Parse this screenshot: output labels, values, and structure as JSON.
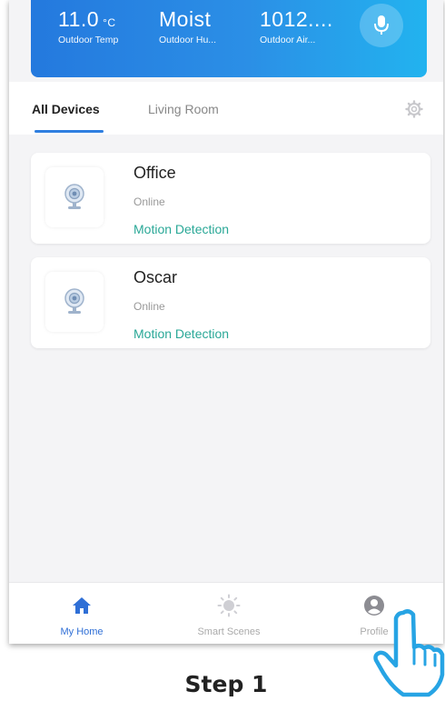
{
  "weather": {
    "temp": {
      "value": "11.0",
      "unit": "°C",
      "label": "Outdoor Temp"
    },
    "humidity": {
      "value": "Moist",
      "label": "Outdoor Hu..."
    },
    "air": {
      "value": "1012....",
      "label": "Outdoor Air..."
    },
    "mic_icon": "microphone-icon"
  },
  "tabs": {
    "items": [
      {
        "label": "All Devices",
        "active": true
      },
      {
        "label": "Living Room",
        "active": false
      }
    ],
    "settings_icon": "gear-icon"
  },
  "devices": [
    {
      "name": "Office",
      "status": "Online",
      "feature": "Motion Detection",
      "icon": "camera-icon"
    },
    {
      "name": "Oscar",
      "status": "Online",
      "feature": "Motion Detection",
      "icon": "camera-icon"
    }
  ],
  "nav": {
    "items": [
      {
        "label": "My Home",
        "icon": "home-icon",
        "active": true
      },
      {
        "label": "Smart Scenes",
        "icon": "sun-icon",
        "active": false
      },
      {
        "label": "Profile",
        "icon": "profile-icon",
        "active": false
      }
    ]
  },
  "caption": "Step 1",
  "colors": {
    "accent": "#2f7fe0",
    "feature_text": "#2aa897",
    "header_start": "#2479de",
    "header_end": "#22b3ef"
  }
}
